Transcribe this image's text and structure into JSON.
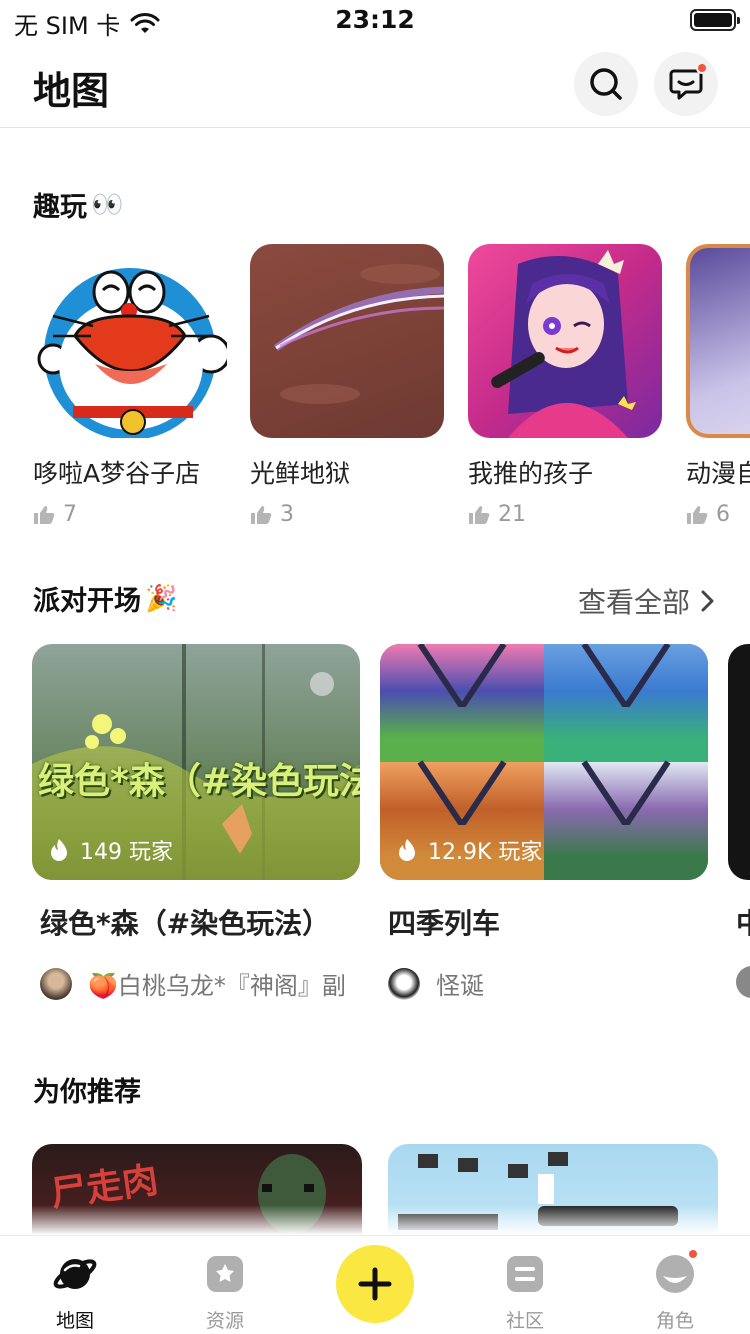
{
  "status_bar": {
    "carrier": "无 SIM 卡",
    "time": "23:12",
    "battery_level": 1.0
  },
  "header": {
    "title": "地图",
    "search_icon": "search-icon",
    "message_icon": "message-icon",
    "message_badge": true
  },
  "fun_section": {
    "title": "趣玩",
    "emoji": "👀",
    "items": [
      {
        "name": "哆啦A梦谷子店",
        "likes": "7"
      },
      {
        "name": "光鲜地狱",
        "likes": "3"
      },
      {
        "name": "我推的孩子",
        "likes": "21"
      },
      {
        "name": "动漫自",
        "likes": "6"
      }
    ]
  },
  "party_section": {
    "title": "派对开场",
    "emoji": "🎉",
    "see_all": "查看全部",
    "items": [
      {
        "name": "绿色*森（#染色玩法）",
        "players": "149 玩家",
        "author": "🍑白桃乌龙*『神阁』副",
        "overlay_text": "绿色*森（#染色玩法）"
      },
      {
        "name": "四季列车",
        "players": "12.9K 玩家",
        "author": "怪诞"
      },
      {
        "name": "中",
        "players": "",
        "author": ""
      }
    ]
  },
  "recommend_section": {
    "title": "为你推荐",
    "items": [
      {
        "overlay_text": "尸走肉"
      },
      {
        "overlay_text": ""
      }
    ]
  },
  "tab_bar": {
    "items": [
      {
        "label": "地图",
        "icon": "planet-icon",
        "active": true
      },
      {
        "label": "资源",
        "icon": "resource-icon",
        "active": false
      },
      {
        "label": "",
        "icon": "plus-icon",
        "active": false
      },
      {
        "label": "社区",
        "icon": "community-icon",
        "active": false
      },
      {
        "label": "角色",
        "icon": "character-icon",
        "active": false,
        "badge": true
      }
    ]
  },
  "colors": {
    "accent_yellow": "#fae742",
    "badge_red": "#f2553c",
    "text_primary": "#111111",
    "text_secondary": "#9a9a9a"
  }
}
